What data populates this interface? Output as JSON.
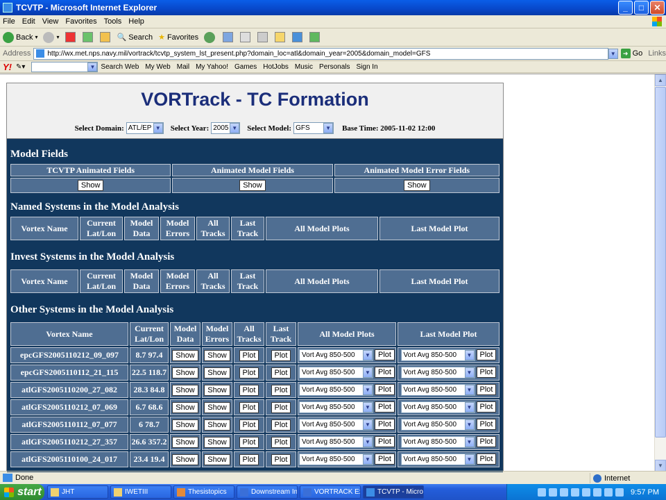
{
  "window": {
    "title": "TCVTP - Microsoft Internet Explorer",
    "controls": [
      "_",
      "□",
      "✕"
    ]
  },
  "menu": [
    "File",
    "Edit",
    "View",
    "Favorites",
    "Tools",
    "Help"
  ],
  "toolbar": {
    "back": "Back",
    "search": "Search",
    "favorites": "Favorites"
  },
  "address": {
    "label": "Address",
    "url": "http://wx.met.nps.navy.mil/vortrack/tcvtp_system_lst_present.php?domain_loc=atl&domain_year=2005&domain_model=GFS",
    "go": "Go",
    "links": "Links"
  },
  "yahoo_bar": {
    "logo": "Y!",
    "search_web": "Search Web",
    "items": [
      "My Web",
      "Mail",
      "My Yahoo!",
      "Games",
      "HotJobs",
      "Music",
      "Personals",
      "Sign In"
    ]
  },
  "page": {
    "title": "VORTrack - TC Formation",
    "select_domain_label": "Select Domain:",
    "domain_value": "ATL/EP",
    "select_year_label": "Select Year:",
    "year_value": "2005",
    "select_model_label": "Select Model:",
    "model_value": "GFS",
    "base_time": "Base Time: 2005-11-02 12:00"
  },
  "model_fields": {
    "title": "Model Fields",
    "headers": [
      "TCVTP Animated Fields",
      "Animated Model Fields",
      "Animated Model Error Fields"
    ],
    "show_label": "Show"
  },
  "named_systems": {
    "title": "Named Systems in the Model Analysis",
    "headers": [
      "Vortex Name",
      "Current Lat/Lon",
      "Model Data",
      "Model Errors",
      "All Tracks",
      "Last Track",
      "All Model Plots",
      "Last Model Plot"
    ]
  },
  "invest_systems": {
    "title": "Invest Systems in the Model Analysis",
    "headers": [
      "Vortex Name",
      "Current Lat/Lon",
      "Model Data",
      "Model Errors",
      "All Tracks",
      "Last Track",
      "All Model Plots",
      "Last Model Plot"
    ]
  },
  "other_systems": {
    "title": "Other Systems in the Model Analysis",
    "headers": [
      "Vortex Name",
      "Current Lat/Lon",
      "Model Data",
      "Model Errors",
      "All Tracks",
      "Last Track",
      "All Model Plots",
      "Last Model Plot"
    ],
    "show_label": "Show",
    "plot_label": "Plot",
    "combo_value": "Vort Avg 850-500",
    "rows": [
      {
        "name": "epcGFS2005110212_09_097",
        "latlon": "8.7 97.4"
      },
      {
        "name": "epcGFS2005110112_21_115",
        "latlon": "22.5 118.7"
      },
      {
        "name": "atlGFS2005110200_27_082",
        "latlon": "28.3 84.8"
      },
      {
        "name": "atlGFS2005110212_07_069",
        "latlon": "6.7 68.6"
      },
      {
        "name": "atlGFS2005110112_07_077",
        "latlon": "6 78.7"
      },
      {
        "name": "atlGFS2005110212_27_357",
        "latlon": "26.6 357.2"
      },
      {
        "name": "atlGFS2005110100_24_017",
        "latlon": "23.4 19.4"
      }
    ]
  },
  "status": {
    "text": "Done",
    "zone": "Internet"
  },
  "taskbar": {
    "start": "start",
    "tasks": [
      "JHT",
      "IWETIII",
      "Thesistopics",
      "Downstream Im...",
      "VORTRACK Exa...",
      "TCVTP - Microso..."
    ],
    "clock": "9:57 PM"
  }
}
